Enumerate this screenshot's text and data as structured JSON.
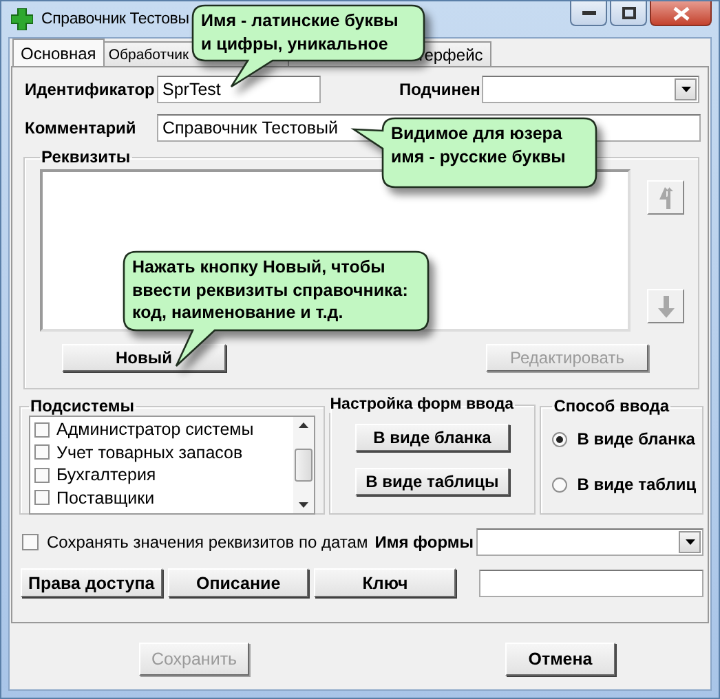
{
  "window": {
    "title": "Справочник Тестовы"
  },
  "tabs": [
    {
      "label": "Основная",
      "selected": true
    },
    {
      "label": "Обработчик",
      "selected": false
    },
    {
      "label": "терфейс",
      "selected": false
    }
  ],
  "identifier": {
    "label": "Идентификатор",
    "value": "SprTest"
  },
  "parent": {
    "label": "Подчинен"
  },
  "comment": {
    "label": "Комментарий",
    "value": "Справочник Тестовый"
  },
  "requisites": {
    "title": "Реквизиты",
    "move_buttons": [
      {
        "kind": "up",
        "disabled": true
      },
      {
        "kind": "down",
        "disabled": true
      }
    ],
    "buttons": [
      {
        "label": "Новый",
        "disabled": false
      },
      {
        "label": "Редактировать",
        "disabled": true
      }
    ]
  },
  "subsystems": {
    "title": "Подсистемы",
    "items": [
      {
        "label": "Администратор системы",
        "checked": false
      },
      {
        "label": "Учет товарных запасов",
        "checked": false
      },
      {
        "label": "Бухгалтерия",
        "checked": false
      },
      {
        "label": "Поставщики",
        "checked": false
      }
    ]
  },
  "form_setup": {
    "title": "Настройка форм ввода",
    "buttons": [
      "В виде бланка",
      "В виде таблицы"
    ]
  },
  "input_mode": {
    "title": "Способ ввода",
    "options": [
      {
        "label": "В виде бланка",
        "selected": true
      },
      {
        "label": "В виде таблиц",
        "selected": false
      }
    ]
  },
  "save_by_dates": {
    "label": "Сохранять значения реквизитов по датам",
    "checked": false
  },
  "form_name": {
    "label": "Имя формы"
  },
  "action_buttons": [
    "Права доступа",
    "Описание",
    "Ключ"
  ],
  "footer_buttons": [
    {
      "label": "Сохранить",
      "disabled": true
    },
    {
      "label": "Отмена",
      "disabled": false
    }
  ],
  "callouts": [
    {
      "text": "Имя - латинские буквы\nи цифры, уникальное"
    },
    {
      "text": "Видимое для юзера\nимя - русские буквы"
    },
    {
      "text": "Нажать кнопку Новый, чтобы\nввести реквизиты справочника:\nкод, наименование и т.д."
    }
  ]
}
